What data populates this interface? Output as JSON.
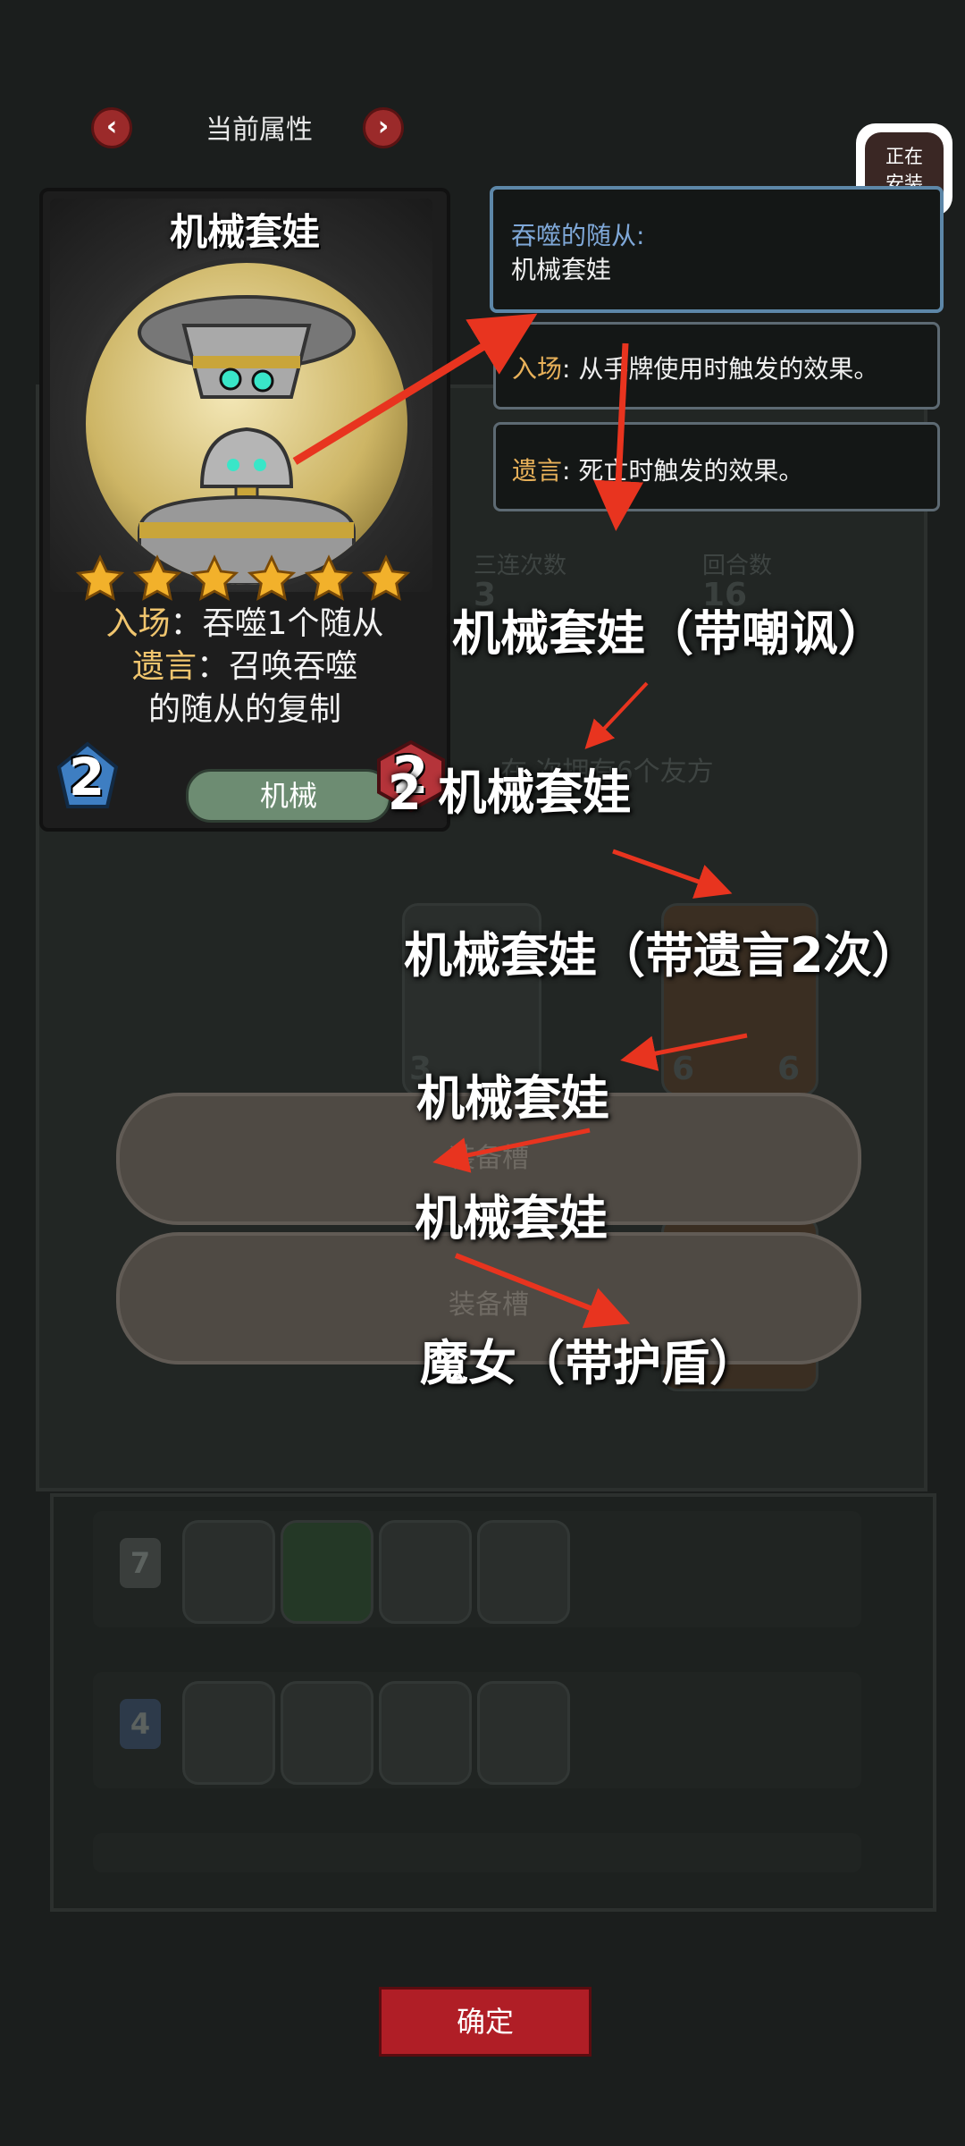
{
  "header": {
    "title": "当前属性",
    "prev_icon": "chevron-left-icon",
    "next_icon": "chevron-right-icon"
  },
  "installing_badge": {
    "line1": "正在",
    "line2": "安装"
  },
  "card": {
    "name": "机械套娃",
    "stars": 6,
    "desc_line1_kw": "入场",
    "desc_line1": "：吞噬1个随从",
    "desc_line2_kw": "遗言",
    "desc_line2": "：召唤吞噬",
    "desc_line3": "的随从的复制",
    "attack": "2",
    "health": "2",
    "tribe": "机械"
  },
  "tooltips": {
    "devoured_label": "吞噬的随从:",
    "devoured_value": "机械套娃",
    "battlecry_kw": "入场",
    "battlecry_text": ": 从手牌使用时触发的效果。",
    "deathrattle_kw": "遗言",
    "deathrattle_text": ": 死亡时触发的效果。"
  },
  "background": {
    "stat_triple": "三连次数",
    "stat_triple_val": "3",
    "stat_round": "回合数",
    "stat_round_val": "16",
    "quest_text": "在 次拥有6个友方",
    "minion_stat_a": "3",
    "minion_stat_b": "6",
    "minion_stat_c": "6",
    "bench_badge_1": "7",
    "bench_badge_2": "4"
  },
  "equip_slots": [
    "装备槽",
    "装备槽"
  ],
  "annotations": [
    "机械套娃（带嘲讽）",
    "2 机械套娃",
    "机械套娃（带遗言2次）",
    "机械套娃",
    "机械套娃",
    "魔女（带护盾）"
  ],
  "confirm_label": "确定",
  "colors": {
    "arrow_red": "#e8341f",
    "keyword_gold": "#f0c56e",
    "confirm_red": "#b01e26"
  }
}
